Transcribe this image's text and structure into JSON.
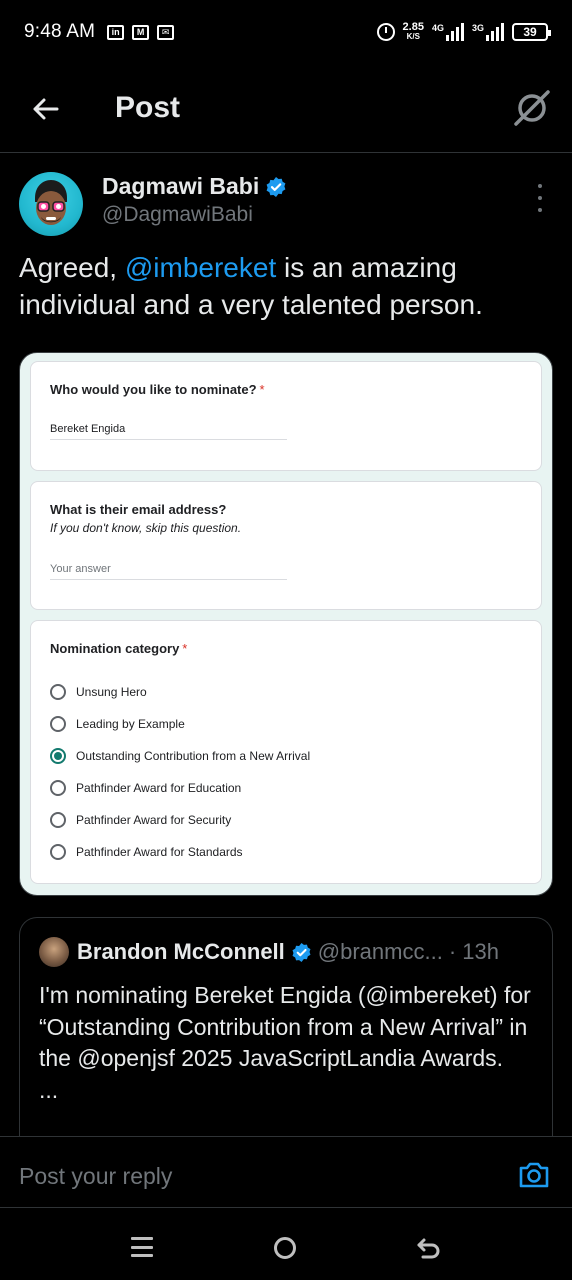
{
  "status_bar": {
    "time": "9:48 AM",
    "app_icons": [
      "in",
      "M",
      "✉"
    ],
    "net_speed": "2.85",
    "net_unit": "K/S",
    "sim1_label": "4G",
    "sim2_label": "3G",
    "battery": "39"
  },
  "header": {
    "title": "Post"
  },
  "post": {
    "author_name": "Dagmawi Babi",
    "author_handle": "@DagmawiBabi",
    "text_before": "Agreed, ",
    "mention": "@imbereket",
    "text_after": " is an amazing individual and a very talented person."
  },
  "form": {
    "q1": {
      "title": "Who would you like to nominate?",
      "required": "*",
      "answer": "Bereket Engida"
    },
    "q2": {
      "title": "What is their email address?",
      "help": "If you don't know, skip this question.",
      "placeholder": "Your answer"
    },
    "q3": {
      "title": "Nomination category",
      "required": "*",
      "options": [
        {
          "label": "Unsung Hero",
          "checked": false
        },
        {
          "label": "Leading by Example",
          "checked": false
        },
        {
          "label": "Outstanding Contribution from a New Arrival",
          "checked": true
        },
        {
          "label": "Pathfinder Award for Education",
          "checked": false
        },
        {
          "label": "Pathfinder Award for Security",
          "checked": false
        },
        {
          "label": "Pathfinder Award for Standards",
          "checked": false
        }
      ]
    }
  },
  "quote": {
    "author_name": "Brandon McConnell",
    "author_handle": "@branmcc...",
    "time": "· 13h",
    "text": "I'm nominating Bereket Engida (@imbereket) for “Outstanding Contribution from a New Arrival” in the @openjsf 2025 JavaScriptLandia Awards.",
    "ellipsis": "..."
  },
  "reply": {
    "placeholder": "Post your reply"
  },
  "colors": {
    "accent": "#1d9bf0",
    "form_selected": "#137a6e",
    "required": "#d93025"
  }
}
